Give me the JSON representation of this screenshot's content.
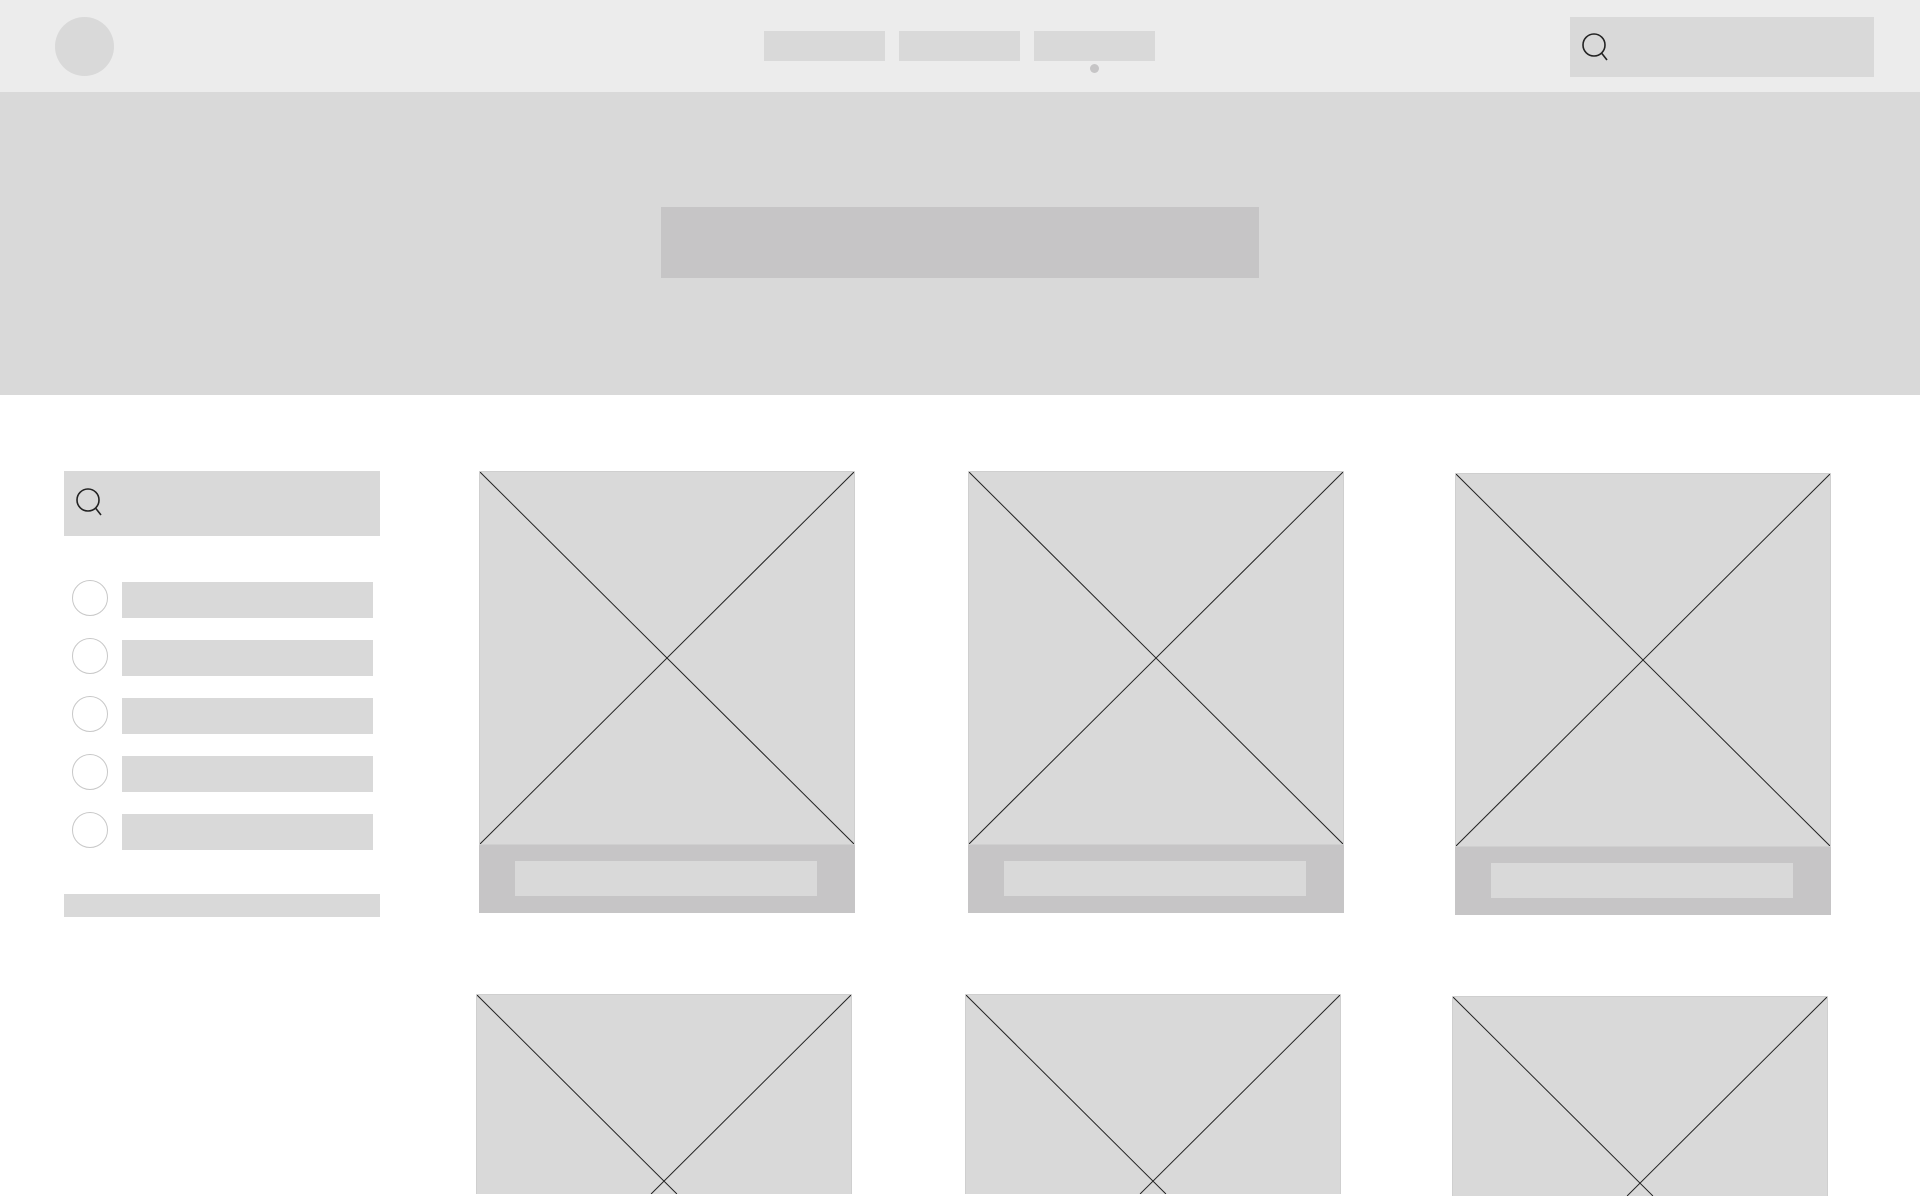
{
  "colors": {
    "header_bg": "#ececec",
    "placeholder": "#d9d9d9",
    "placeholder_dark": "#c6c5c6",
    "line": "#222222",
    "page_bg": "#ffffff"
  },
  "header": {
    "logo": "logo-placeholder",
    "nav": [
      {
        "label": ""
      },
      {
        "label": ""
      },
      {
        "label": ""
      }
    ],
    "active_nav_index": 2,
    "search": {
      "icon": "search-icon",
      "placeholder": ""
    }
  },
  "hero": {
    "title": ""
  },
  "sidebar": {
    "search": {
      "icon": "search-icon",
      "placeholder": ""
    },
    "filters": [
      {
        "label": "",
        "checked": false
      },
      {
        "label": "",
        "checked": false
      },
      {
        "label": "",
        "checked": false
      },
      {
        "label": "",
        "checked": false
      },
      {
        "label": "",
        "checked": false
      }
    ]
  },
  "products": [
    {
      "image": "image-placeholder",
      "label": ""
    },
    {
      "image": "image-placeholder",
      "label": ""
    },
    {
      "image": "image-placeholder",
      "label": ""
    },
    {
      "image": "image-placeholder",
      "label": ""
    },
    {
      "image": "image-placeholder",
      "label": ""
    },
    {
      "image": "image-placeholder",
      "label": ""
    }
  ]
}
